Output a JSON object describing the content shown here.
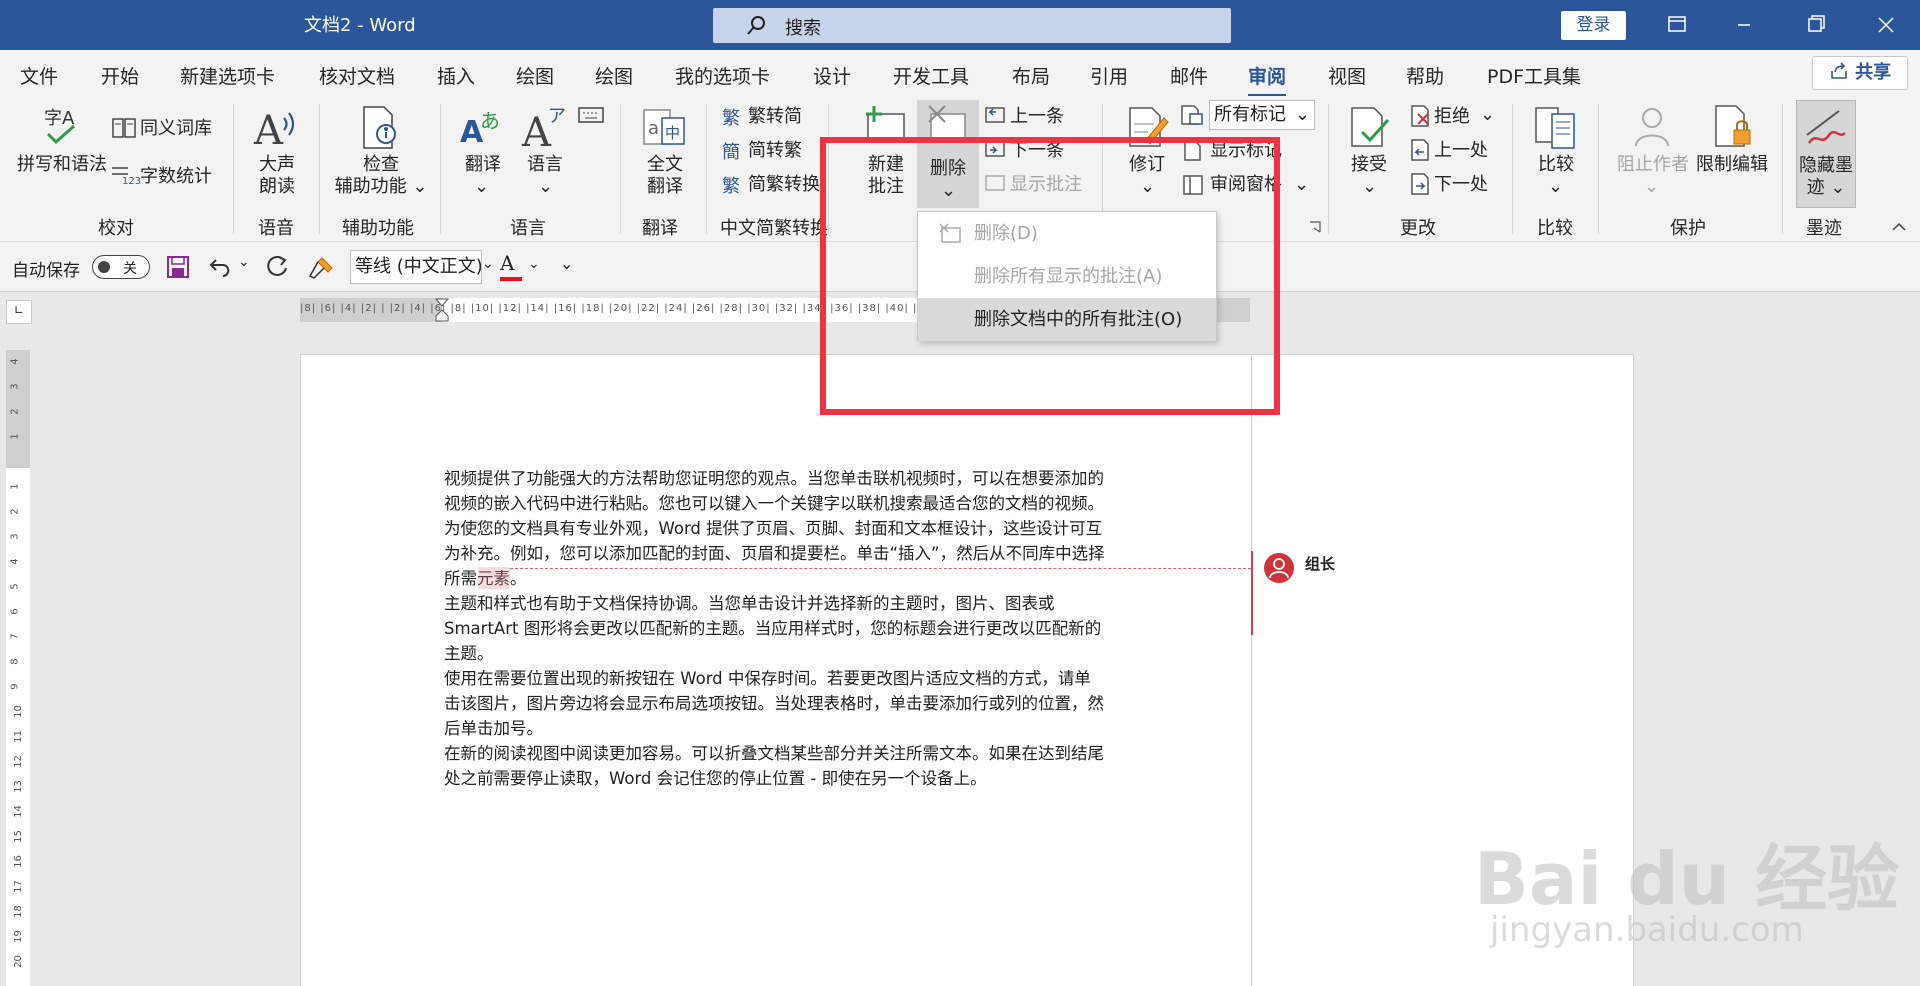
{
  "titlebar": {
    "title": "文档2  -  Word",
    "search_placeholder": "搜索",
    "login": "登录"
  },
  "tabs": [
    "文件",
    "开始",
    "新建选项卡",
    "核对文档",
    "插入",
    "绘图",
    "绘图",
    "我的选项卡",
    "设计",
    "开发工具",
    "布局",
    "引用",
    "邮件",
    "审阅",
    "视图",
    "帮助",
    "PDF工具集"
  ],
  "active_tab": "审阅",
  "share_label": "共享",
  "ribbon": {
    "spell": "拼写和语法",
    "thesaurus": "同义词库",
    "word_count": "字数统计",
    "read_aloud": [
      "大声",
      "朗读"
    ],
    "check_access": [
      "检查",
      "辅助功能"
    ],
    "translate": "翻译",
    "language": "语言",
    "full_translate": [
      "全文",
      "翻译"
    ],
    "trad_to_simp": "繁转简",
    "simp_to_trad": "简转繁",
    "simp_trad_convert": "简繁转换",
    "new_comment": [
      "新建",
      "批注"
    ],
    "delete": "删除",
    "prev": "上一条",
    "next": "下一条",
    "show_comments": "显示批注",
    "track_changes": "修订",
    "markup_select": "所有标记",
    "show_markup": "显示标记",
    "review_pane": "审阅窗格",
    "accept": "接受",
    "reject": "拒绝",
    "prev_change": "上一处",
    "next_change": "下一处",
    "compare": "比较",
    "block_authors": "阻止作者",
    "restrict_editing": "限制编辑",
    "hide_ink": [
      "隐藏墨",
      "迹"
    ],
    "groups": {
      "proofing": "校对",
      "speech": "语音",
      "accessibility": "辅助功能",
      "language": "语言",
      "translate": "翻译",
      "chinese": "中文简繁转换",
      "changes": "更改",
      "compare": "比较",
      "protect": "保护",
      "ink": "墨迹"
    }
  },
  "qat": {
    "autosave": "自动保存",
    "toggle": "关",
    "font": "等线 (中文正文)"
  },
  "dropdown": {
    "items": [
      "删除(D)",
      "删除所有显示的批注(A)",
      "删除文档中的所有批注(O)"
    ],
    "active_index": 2
  },
  "document": {
    "paragraphs": [
      [
        "视频提供了功能强大的方法帮助您证明您的观点。当您单击联机视频时，可以在想要添加的",
        "视频的嵌入代码中进行粘贴。您也可以键入一个关键字以联机搜索最适合您的文档的视频。",
        "为使您的文档具有专业外观，Word 提供了页眉、页脚、封面和文本框设计，这些设计可互",
        "为补充。例如，您可以添加匹配的封面、页眉和提要栏。单击“插入”，然后从不同库中选择",
        "所需元素。"
      ],
      [
        "主题和样式也有助于文档保持协调。当您单击设计并选择新的主题时，图片、图表或",
        "SmartArt 图形将会更改以匹配新的主题。当应用样式时，您的标题会进行更改以匹配新的",
        "主题。"
      ],
      [
        "使用在需要位置出现的新按钮在 Word 中保存时间。若要更改图片适应文档的方式，请单",
        "击该图片，图片旁边将会显示布局选项按钮。当处理表格时，单击要添加行或列的位置，然",
        "后单击加号。"
      ],
      [
        "在新的阅读视图中阅读更加容易。可以折叠文档某些部分并关注所需文本。如果在达到结尾",
        "处之前需要停止读取，Word 会记住您的停止位置 - 即使在另一个设备上。"
      ]
    ],
    "comment_author": "组长"
  },
  "ruler_h": "|8| |6| |4| |2| |  |2| |4| |6| |8| |10| |12| |14| |16| |18| |20| |22| |24| |26| |28| |30| |32| |34| |36| |38| |40| |42| |44| |46| |48",
  "watermark": {
    "brand": "Bai du 经验",
    "url": "jingyan.baidu.com"
  },
  "colors": {
    "brand": "#2b579a",
    "highlight_box": "#ef3340",
    "comment": "#d13438"
  }
}
